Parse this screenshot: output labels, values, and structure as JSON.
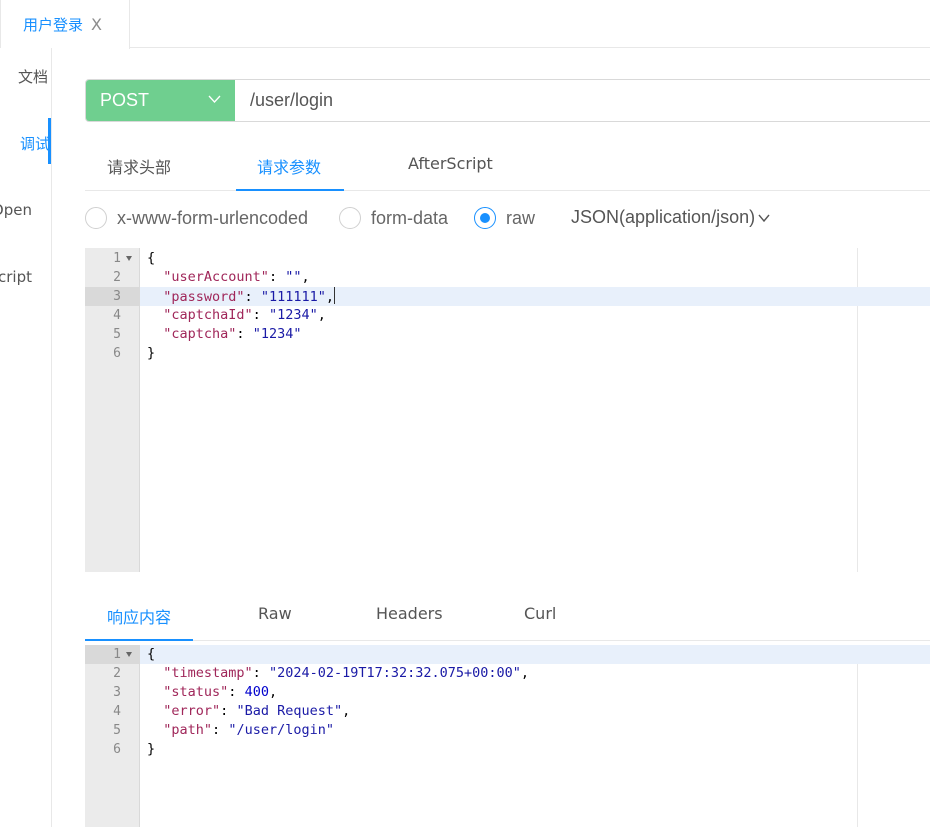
{
  "top_tabs": [
    {
      "label": "用户登录",
      "close": "X"
    }
  ],
  "sidebar": {
    "items": [
      {
        "label": "文档"
      },
      {
        "label": "调试"
      },
      {
        "label": "Open"
      },
      {
        "label": "Script"
      }
    ]
  },
  "request": {
    "method": "POST",
    "url": "/user/login"
  },
  "request_tabs": [
    "请求头部",
    "请求参数",
    "AfterScript"
  ],
  "body_types": {
    "options": [
      "x-www-form-urlencoded",
      "form-data",
      "raw"
    ],
    "selected": "raw",
    "content_type": "JSON(application/json)"
  },
  "request_body": {
    "lines": [
      {
        "num": "1",
        "parts": [
          {
            "t": "p",
            "v": "{"
          }
        ]
      },
      {
        "num": "2",
        "parts": [
          {
            "t": "p",
            "v": "  "
          },
          {
            "t": "k",
            "v": "\"userAccount\""
          },
          {
            "t": "p",
            "v": ": "
          },
          {
            "t": "s",
            "v": "\"\""
          },
          {
            "t": "p",
            "v": ","
          }
        ]
      },
      {
        "num": "3",
        "parts": [
          {
            "t": "p",
            "v": "  "
          },
          {
            "t": "k",
            "v": "\"password\""
          },
          {
            "t": "p",
            "v": ": "
          },
          {
            "t": "s",
            "v": "\"111111\""
          },
          {
            "t": "p",
            "v": ","
          }
        ]
      },
      {
        "num": "4",
        "parts": [
          {
            "t": "p",
            "v": "  "
          },
          {
            "t": "k",
            "v": "\"captchaId\""
          },
          {
            "t": "p",
            "v": ": "
          },
          {
            "t": "s",
            "v": "\"1234\""
          },
          {
            "t": "p",
            "v": ","
          }
        ]
      },
      {
        "num": "5",
        "parts": [
          {
            "t": "p",
            "v": "  "
          },
          {
            "t": "k",
            "v": "\"captcha\""
          },
          {
            "t": "p",
            "v": ": "
          },
          {
            "t": "s",
            "v": "\"1234\""
          }
        ]
      },
      {
        "num": "6",
        "parts": [
          {
            "t": "p",
            "v": "}"
          }
        ]
      }
    ]
  },
  "response_tabs": [
    "响应内容",
    "Raw",
    "Headers",
    "Curl"
  ],
  "response_body": {
    "lines": [
      {
        "num": "1",
        "parts": [
          {
            "t": "p",
            "v": "{"
          }
        ]
      },
      {
        "num": "2",
        "parts": [
          {
            "t": "p",
            "v": "  "
          },
          {
            "t": "k",
            "v": "\"timestamp\""
          },
          {
            "t": "p",
            "v": ": "
          },
          {
            "t": "s",
            "v": "\"2024-02-19T17:32:32.075+00:00\""
          },
          {
            "t": "p",
            "v": ","
          }
        ]
      },
      {
        "num": "3",
        "parts": [
          {
            "t": "p",
            "v": "  "
          },
          {
            "t": "k",
            "v": "\"status\""
          },
          {
            "t": "p",
            "v": ": "
          },
          {
            "t": "n",
            "v": "400"
          },
          {
            "t": "p",
            "v": ","
          }
        ]
      },
      {
        "num": "4",
        "parts": [
          {
            "t": "p",
            "v": "  "
          },
          {
            "t": "k",
            "v": "\"error\""
          },
          {
            "t": "p",
            "v": ": "
          },
          {
            "t": "s",
            "v": "\"Bad Request\""
          },
          {
            "t": "p",
            "v": ","
          }
        ]
      },
      {
        "num": "5",
        "parts": [
          {
            "t": "p",
            "v": "  "
          },
          {
            "t": "k",
            "v": "\"path\""
          },
          {
            "t": "p",
            "v": ": "
          },
          {
            "t": "s",
            "v": "\"/user/login\""
          }
        ]
      },
      {
        "num": "6",
        "parts": [
          {
            "t": "p",
            "v": "}"
          }
        ]
      }
    ]
  },
  "colors": {
    "accent": "#1890ff",
    "method_bg": "#6fcf8f",
    "json_key": "#a0275a",
    "json_string": "#1a1aa6",
    "json_number": "#0000cd"
  },
  "icons": {
    "tab_close": "close-icon",
    "method_dropdown": "chevron-down-icon",
    "content_type_dropdown": "chevron-down-icon",
    "fold": "fold-arrow-icon"
  }
}
